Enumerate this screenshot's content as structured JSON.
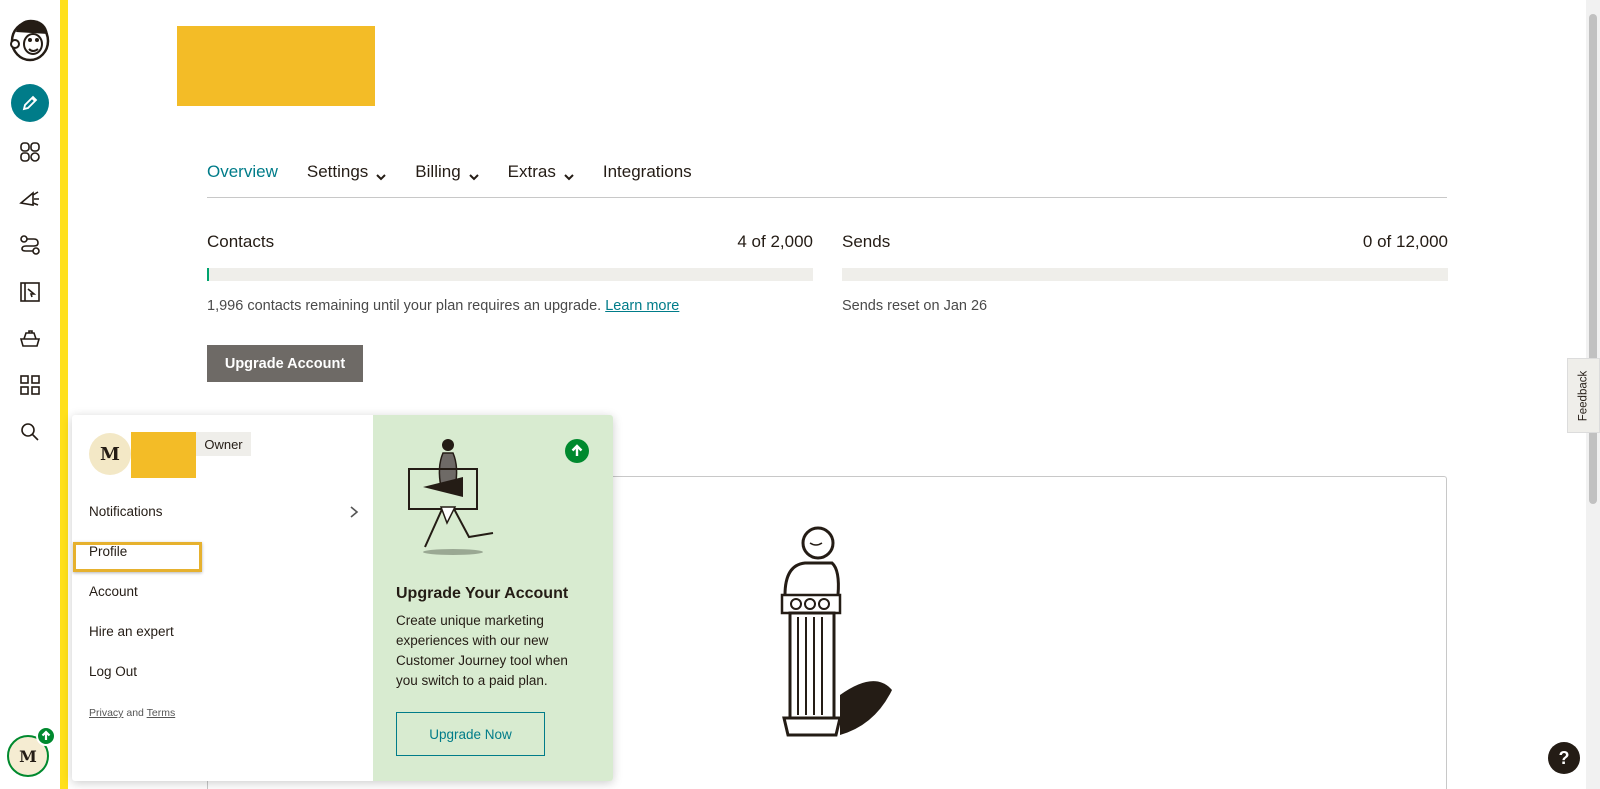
{
  "tabs": [
    {
      "label": "Overview",
      "active": true,
      "has_dropdown": false
    },
    {
      "label": "Settings",
      "active": false,
      "has_dropdown": true
    },
    {
      "label": "Billing",
      "active": false,
      "has_dropdown": true
    },
    {
      "label": "Extras",
      "active": false,
      "has_dropdown": true
    },
    {
      "label": "Integrations",
      "active": false,
      "has_dropdown": false
    }
  ],
  "contacts": {
    "label": "Contacts",
    "count": "4 of 2,000",
    "usage_fraction": 0.002,
    "note": "1,996 contacts remaining until your plan requires an upgrade.",
    "link": "Learn more"
  },
  "sends": {
    "label": "Sends",
    "count": "0 of 12,000",
    "usage_fraction": 0,
    "note": "Sends reset on Jan 26"
  },
  "upgrade_account_label": "Upgrade Account",
  "feedback_label": "Feedback",
  "help_label": "?",
  "rail": {
    "icons": [
      "mailchimp-logo-icon",
      "pencil-icon",
      "audience-icon",
      "campaigns-icon",
      "automations-icon",
      "website-icon",
      "content-studio-icon",
      "integrations-grid-icon",
      "search-icon"
    ],
    "avatar_initial": "M"
  },
  "popup": {
    "avatar_initial": "M",
    "role": "Owner",
    "menu": {
      "notifications": "Notifications",
      "profile": "Profile",
      "account": "Account",
      "hire": "Hire an expert",
      "logout": "Log Out"
    },
    "legal": {
      "privacy": "Privacy",
      "and": "and",
      "terms": "Terms"
    },
    "promo": {
      "title": "Upgrade Your Account",
      "text": "Create unique marketing experiences with our new Customer Journey tool when you switch to a paid plan.",
      "button": "Upgrade Now"
    }
  },
  "colors": {
    "accent": "#007c89",
    "brand_yellow": "#ffe01b",
    "redaction": "#f3bc27",
    "promo_bg": "#d8ebd0",
    "success": "#00892e"
  }
}
